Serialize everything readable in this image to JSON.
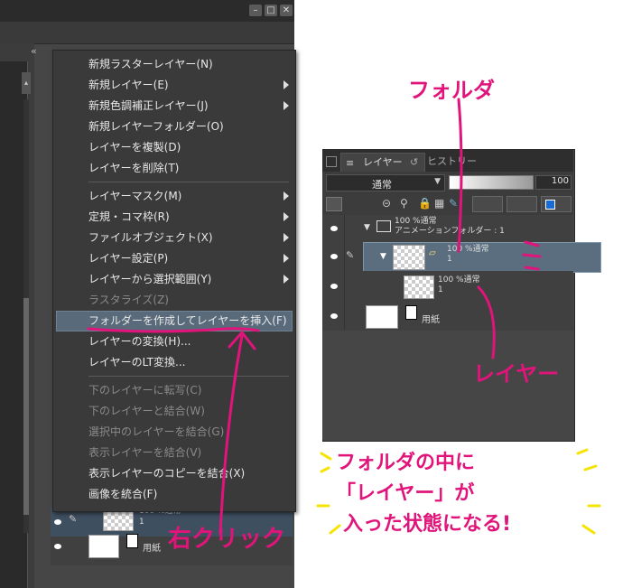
{
  "menu": {
    "items": [
      {
        "label": "新規ラスターレイヤー(N)",
        "submenu": false,
        "disabled": false
      },
      {
        "label": "新規レイヤー(E)",
        "submenu": true,
        "disabled": false
      },
      {
        "label": "新規色調補正レイヤー(J)",
        "submenu": true,
        "disabled": false
      },
      {
        "label": "新規レイヤーフォルダー(O)",
        "submenu": false,
        "disabled": false
      },
      {
        "label": "レイヤーを複製(D)",
        "submenu": false,
        "disabled": false
      },
      {
        "label": "レイヤーを削除(T)",
        "submenu": false,
        "disabled": false
      },
      {
        "label": "レイヤーマスク(M)",
        "submenu": true,
        "disabled": false
      },
      {
        "label": "定規・コマ枠(R)",
        "submenu": true,
        "disabled": false
      },
      {
        "label": "ファイルオブジェクト(X)",
        "submenu": true,
        "disabled": false
      },
      {
        "label": "レイヤー設定(P)",
        "submenu": true,
        "disabled": false
      },
      {
        "label": "レイヤーから選択範囲(Y)",
        "submenu": true,
        "disabled": false
      },
      {
        "label": "ラスタライズ(Z)",
        "submenu": false,
        "disabled": true
      },
      {
        "label": "フォルダーを作成してレイヤーを挿入(F)",
        "submenu": false,
        "disabled": false,
        "highlighted": true
      },
      {
        "label": "レイヤーの変換(H)...",
        "submenu": false,
        "disabled": false
      },
      {
        "label": "レイヤーのLT変換...",
        "submenu": false,
        "disabled": false
      },
      {
        "label": "下のレイヤーに転写(C)",
        "submenu": false,
        "disabled": true
      },
      {
        "label": "下のレイヤーと結合(W)",
        "submenu": false,
        "disabled": true
      },
      {
        "label": "選択中のレイヤーを結合(G)",
        "submenu": false,
        "disabled": true
      },
      {
        "label": "表示レイヤーを結合(V)",
        "submenu": false,
        "disabled": true
      },
      {
        "label": "表示レイヤーのコピーを結合(X)",
        "submenu": false,
        "disabled": false
      },
      {
        "label": "画像を統合(F)",
        "submenu": false,
        "disabled": false
      }
    ]
  },
  "left_layers": {
    "layer1": {
      "blend": "100 %通常",
      "name": "1"
    },
    "paper": {
      "name": "用紙"
    }
  },
  "right_panel": {
    "tabs": {
      "layer": "レイヤー",
      "history": "ヒストリー"
    },
    "blend_mode": "通常",
    "opacity": "100",
    "folder": {
      "blend": "100 %通常",
      "name": "アニメーションフォルダー : 1"
    },
    "selected": {
      "blend": "100 %通常",
      "name": "1"
    },
    "child": {
      "blend": "100 %通常",
      "name": "1"
    },
    "paper": {
      "name": "用紙"
    }
  },
  "annotations": {
    "folder": "フォルダ",
    "layer": "レイヤー",
    "right_click": "右クリック",
    "note_line1": "フォルダの中に",
    "note_line2": "「レイヤー」が",
    "note_line3": "入った状態になる!"
  },
  "colors": {
    "annotation": "#e0147a",
    "highlight_yellow": "#f5e400",
    "selection": "#596a7a"
  }
}
